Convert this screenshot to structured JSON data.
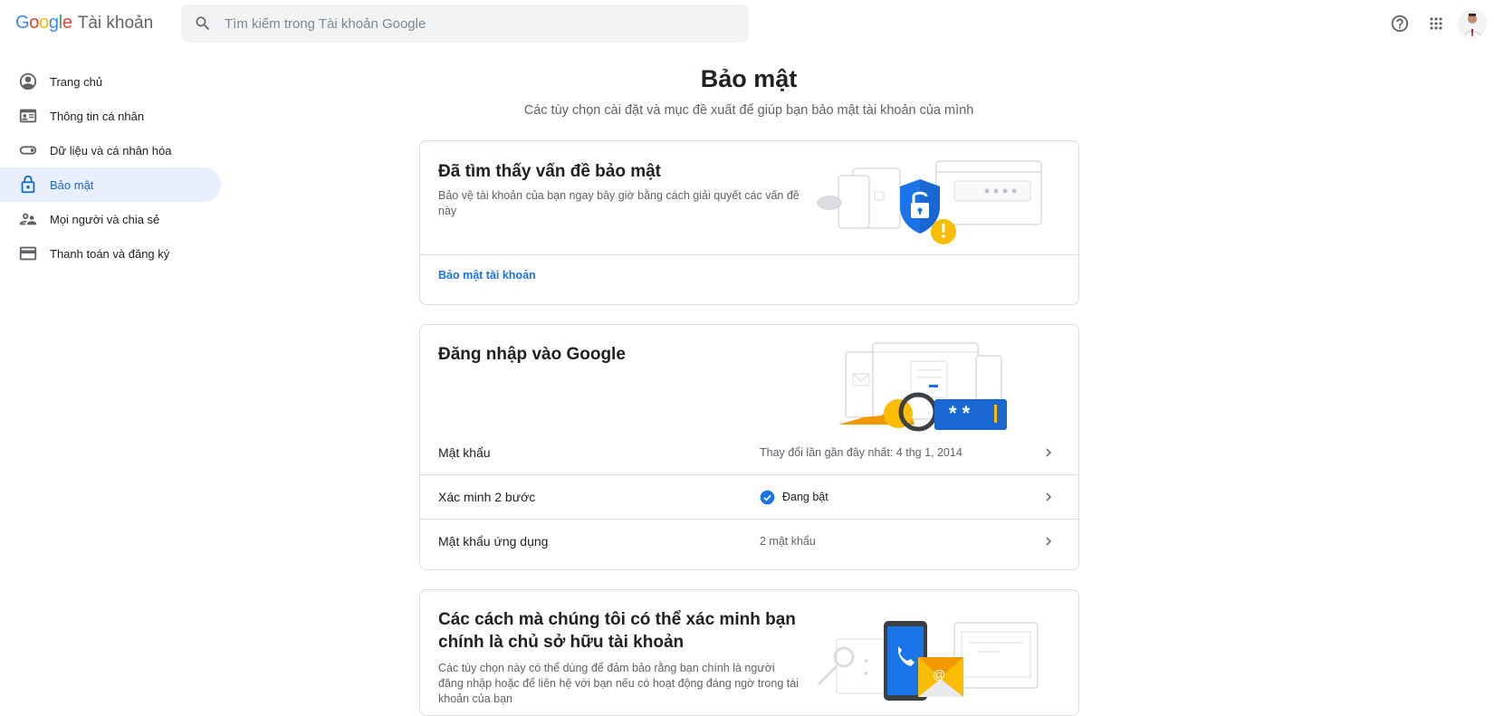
{
  "header": {
    "logo_google": [
      "G",
      "o",
      "o",
      "g",
      "l",
      "e"
    ],
    "product_name": "Tài khoản",
    "search_placeholder": "Tìm kiếm trong Tài khoản Google",
    "icons": [
      "help-icon",
      "apps-icon"
    ]
  },
  "sidebar": {
    "items": [
      {
        "label": "Trang chủ",
        "icon": "home-person-icon",
        "active": false
      },
      {
        "label": "Thông tin cá nhân",
        "icon": "id-card-icon",
        "active": false
      },
      {
        "label": "Dữ liệu và cá nhân hóa",
        "icon": "toggle-icon",
        "active": false
      },
      {
        "label": "Bảo mật",
        "icon": "lock-icon",
        "active": true
      },
      {
        "label": "Mọi người và chia sẻ",
        "icon": "people-icon",
        "active": false
      },
      {
        "label": "Thanh toán và đăng ký",
        "icon": "credit-card-icon",
        "active": false
      }
    ]
  },
  "main": {
    "title": "Bảo mật",
    "subtitle": "Các tùy chọn cài đặt và mục đề xuất để giúp bạn bảo mật tài khoản của mình",
    "issue_card": {
      "title": "Đã tìm thấy vấn đề bảo mật",
      "description": "Bảo vệ tài khoản của bạn ngay bây giờ bằng cách giải quyết các vấn đề này",
      "link": "Bảo mật tài khoản"
    },
    "signin_card": {
      "title": "Đăng nhập vào Google",
      "rows": [
        {
          "label": "Mật khẩu",
          "value": "Thay đổi lần gần đây nhất: 4 thg 1, 2014"
        },
        {
          "label": "Xác minh 2 bước",
          "value": "Đang bật"
        },
        {
          "label": "Mật khẩu ứng dụng",
          "value": "2 mật khẩu"
        }
      ]
    },
    "verify_card": {
      "title_line1": "Các cách mà chúng tôi có thể xác minh bạn",
      "title_line2": "chính là chủ sở hữu tài khoản",
      "description": "Các tùy chọn này có thể dùng để đảm bảo rằng bạn chính là người đăng nhập hoặc để liên hệ với bạn nếu có hoạt động đáng ngờ trong tài khoản của bạn"
    }
  },
  "colors": {
    "accent_blue": "#1a73e8",
    "active_bg": "#e8f0fe",
    "warning_yellow": "#fbbc04",
    "border": "#dadce0"
  }
}
